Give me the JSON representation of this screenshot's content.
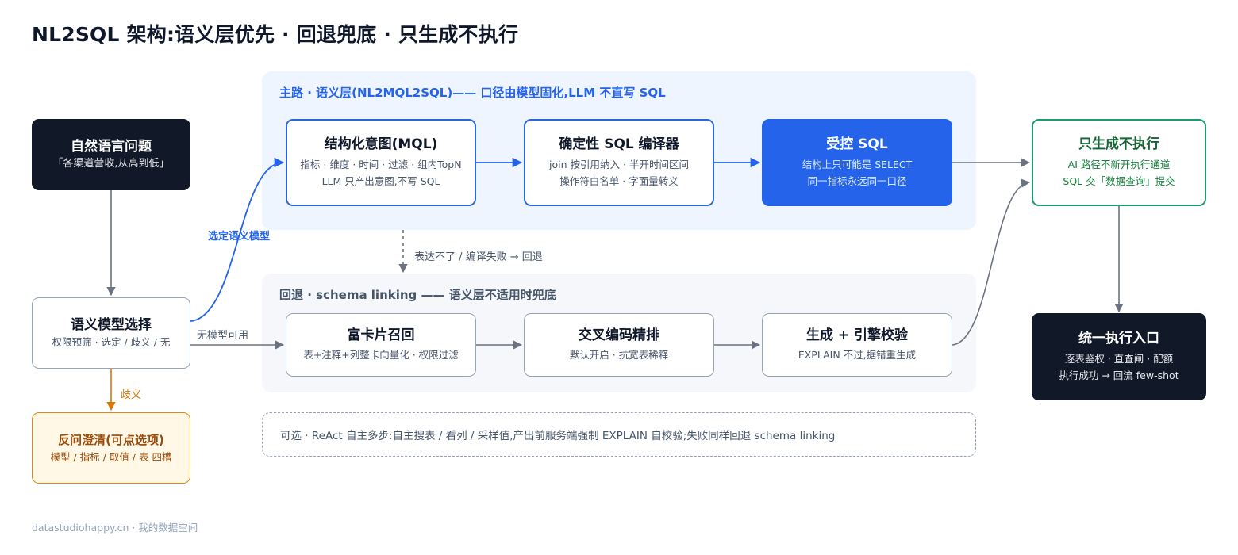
{
  "title": "NL2SQL 架构:语义层优先 · 回退兜底 · 只生成不执行",
  "panels": {
    "main": "主路 · 语义层(NL2MQL2SQL)—— 口径由模型固化,LLM 不直写 SQL",
    "fallback": "回退 · schema linking —— 语义层不适用时兜底"
  },
  "nodes": {
    "nl_question": {
      "title": "自然语言问题",
      "lines": [
        "「各渠道营收,从高到低」"
      ]
    },
    "model_select": {
      "title": "语义模型选择",
      "lines": [
        "权限预筛 · 选定 / 歧义 / 无"
      ]
    },
    "clarify": {
      "title": "反问澄清(可点选项)",
      "lines": [
        "模型 / 指标 / 取值 / 表 四槽"
      ]
    },
    "mql": {
      "title": "结构化意图(MQL)",
      "lines": [
        "指标 · 维度 · 时间 · 过滤 · 组内TopN",
        "LLM 只产出意图,不写 SQL"
      ]
    },
    "compiler": {
      "title": "确定性 SQL 编译器",
      "lines": [
        "join 按引用纳入 · 半开时间区间",
        "操作符白名单 · 字面量转义"
      ]
    },
    "controlled_sql": {
      "title": "受控 SQL",
      "lines": [
        "结构上只可能是 SELECT",
        "同一指标永远同一口径"
      ]
    },
    "gen_only": {
      "title": "只生成不执行",
      "lines": [
        "AI 路径不新开执行通道",
        "SQL 交「数据查询」提交"
      ]
    },
    "recall": {
      "title": "富卡片召回",
      "lines": [
        "表+注释+列整卡向量化 · 权限过滤"
      ]
    },
    "rerank": {
      "title": "交叉编码精排",
      "lines": [
        "默认开启 · 抗宽表稀释"
      ]
    },
    "gen_check": {
      "title": "生成 + 引擎校验",
      "lines": [
        "EXPLAIN 不过,据错重生成"
      ]
    },
    "exec_entry": {
      "title": "统一执行入口",
      "lines": [
        "逐表鉴权 · 直查闸 · 配额",
        "执行成功 → 回流 few-shot"
      ]
    }
  },
  "edge_labels": {
    "selected": "选定语义模型",
    "no_model": "无模型可用",
    "ambiguous": "歧义",
    "fallback": "表达不了 / 编译失败 → 回退"
  },
  "react_note": "可选 · ReAct 自主多步:自主搜表 / 看列 / 采样值,产出前服务端强制 EXPLAIN 自校验;失败同样回退 schema linking",
  "footer": "datastudiohappy.cn · 我的数据空间",
  "colors": {
    "accent_blue": "#2563eb",
    "edge_gray": "#6b7280",
    "edge_orange": "#d97706",
    "dark_node": "#111827",
    "green_border": "#1e9b6c"
  }
}
